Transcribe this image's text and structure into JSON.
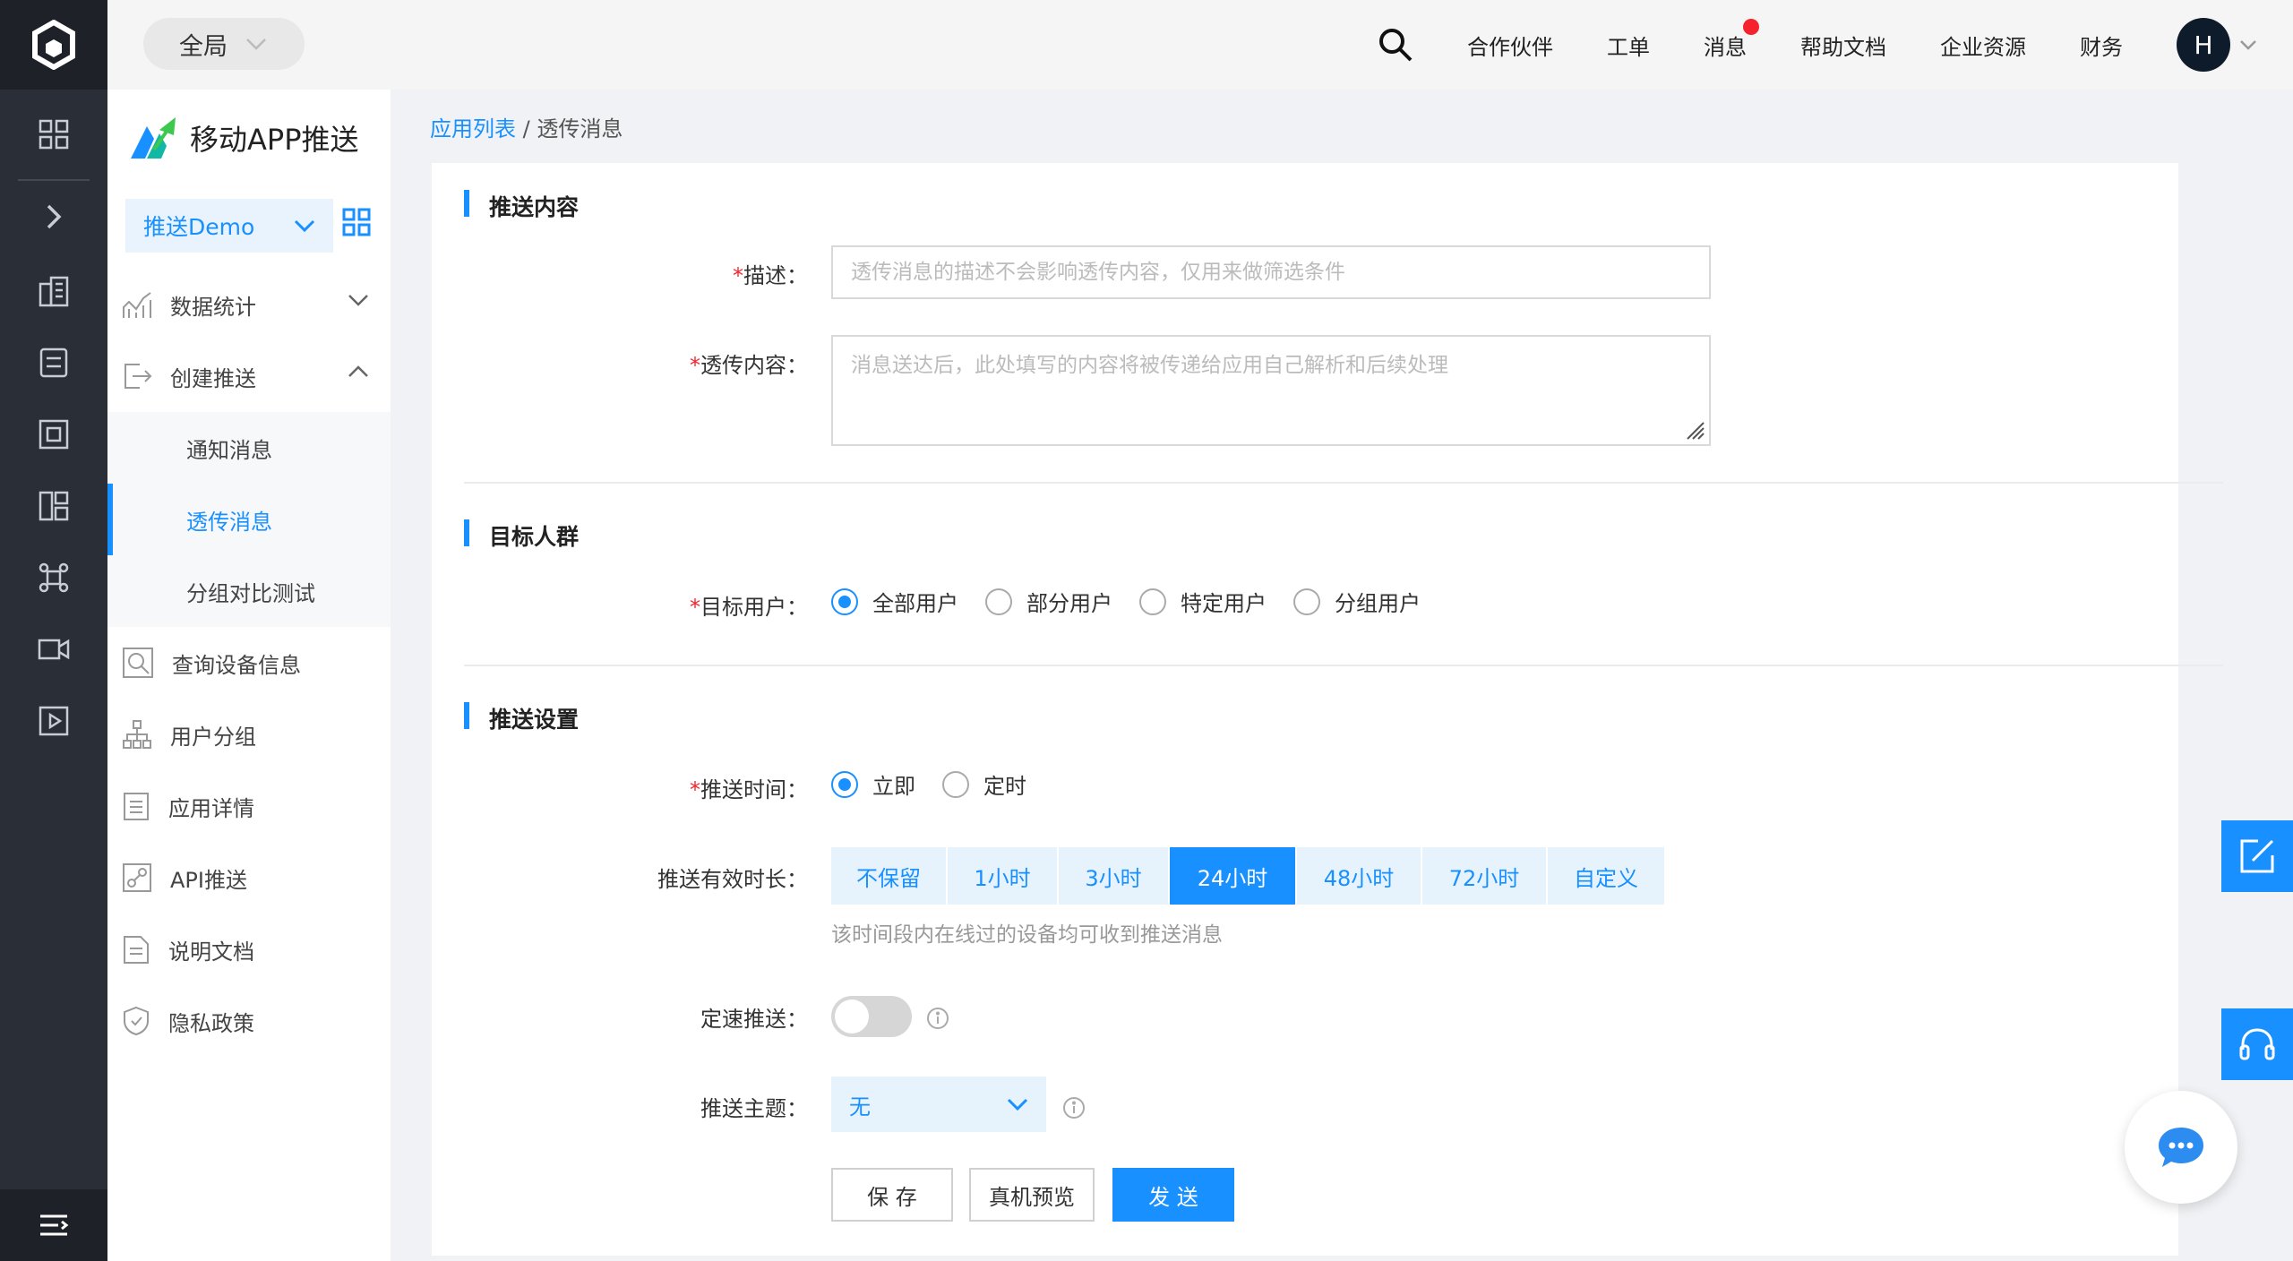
{
  "topbar": {
    "scope_label": "全局",
    "nav": [
      "合作伙伴",
      "工单",
      "消息",
      "帮助文档",
      "企业资源",
      "财务"
    ],
    "avatar_letter": "H"
  },
  "sidebar": {
    "brand": "移动APP推送",
    "app_select": "推送Demo",
    "menu": [
      {
        "label": "数据统计",
        "icon": "chart-icon"
      },
      {
        "label": "创建推送",
        "icon": "export-icon"
      },
      {
        "label": "查询设备信息",
        "icon": "search-device-icon"
      },
      {
        "label": "用户分组",
        "icon": "org-tree-icon"
      },
      {
        "label": "应用详情",
        "icon": "list-doc-icon"
      },
      {
        "label": "API推送",
        "icon": "api-link-icon"
      },
      {
        "label": "说明文档",
        "icon": "document-icon"
      },
      {
        "label": "隐私政策",
        "icon": "shield-icon"
      }
    ],
    "submenu": [
      "通知消息",
      "透传消息",
      "分组对比测试"
    ],
    "active_submenu": "透传消息"
  },
  "breadcrumb": {
    "link": "应用列表",
    "separator": " / ",
    "current": "透传消息"
  },
  "sections": {
    "content": {
      "title": "推送内容",
      "desc_label": "描述：",
      "desc_placeholder": "透传消息的描述不会影响透传内容，仅用来做筛选条件",
      "body_label": "透传内容：",
      "body_placeholder": "消息送达后，此处填写的内容将被传递给应用自己解析和后续处理"
    },
    "target": {
      "title": "目标人群",
      "label": "目标用户：",
      "options": [
        "全部用户",
        "部分用户",
        "特定用户",
        "分组用户"
      ],
      "selected": "全部用户"
    },
    "settings": {
      "title": "推送设置",
      "time_label": "推送时间：",
      "time_options": [
        "立即",
        "定时"
      ],
      "time_selected": "立即",
      "ttl_label": "推送有效时长：",
      "ttl_options": [
        "不保留",
        "1小时",
        "3小时",
        "24小时",
        "48小时",
        "72小时",
        "自定义"
      ],
      "ttl_selected": "24小时",
      "ttl_hint": "该时间段内在线过的设备均可收到推送消息",
      "rate_label": "定速推送：",
      "rate_enabled": false,
      "topic_label": "推送主题：",
      "topic_value": "无"
    }
  },
  "actions": {
    "save": "保 存",
    "preview": "真机预览",
    "send": "发 送"
  },
  "colors": {
    "accent": "#1890ff",
    "rail": "#2a2e36",
    "required": "#f5222d"
  }
}
